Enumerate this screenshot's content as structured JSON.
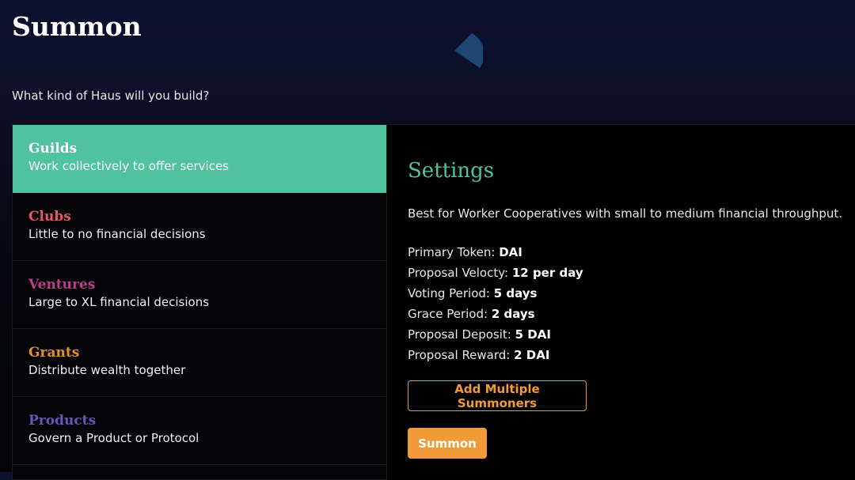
{
  "header": {
    "title": "Summon",
    "subtitle": "What kind of Haus will you build?"
  },
  "daoTypes": [
    {
      "name": "Guilds",
      "description": "Work collectively to offer services",
      "color": "#ffffff",
      "selected": true
    },
    {
      "name": "Clubs",
      "description": "Little to no financial decisions",
      "color": "#e8585c",
      "selected": false
    },
    {
      "name": "Ventures",
      "description": "Large to XL financial decisions",
      "color": "#b73f8d",
      "selected": false
    },
    {
      "name": "Grants",
      "description": "Distribute wealth together",
      "color": "#e8902c",
      "selected": false
    },
    {
      "name": "Products",
      "description": "Govern a Product or Protocol",
      "color": "#6a55b8",
      "selected": false
    }
  ],
  "settings": {
    "title": "Settings",
    "description": "Best for Worker Cooperatives with small to medium financial throughput.",
    "items": [
      {
        "label": "Primary Token: ",
        "value": "DAI"
      },
      {
        "label": "Proposal Velocty: ",
        "value": "12 per day"
      },
      {
        "label": "Voting Period: ",
        "value": "5 days"
      },
      {
        "label": "Grace Period: ",
        "value": "2 days"
      },
      {
        "label": "Proposal Deposit: ",
        "value": "5 DAI"
      },
      {
        "label": "Proposal Reward: ",
        "value": "2 DAI"
      }
    ],
    "add_summoners_label": "Add Multiple Summoners",
    "summon_label": "Summon"
  },
  "colors": {
    "accent_green": "#4fc29e",
    "accent_orange": "#f09b38"
  }
}
